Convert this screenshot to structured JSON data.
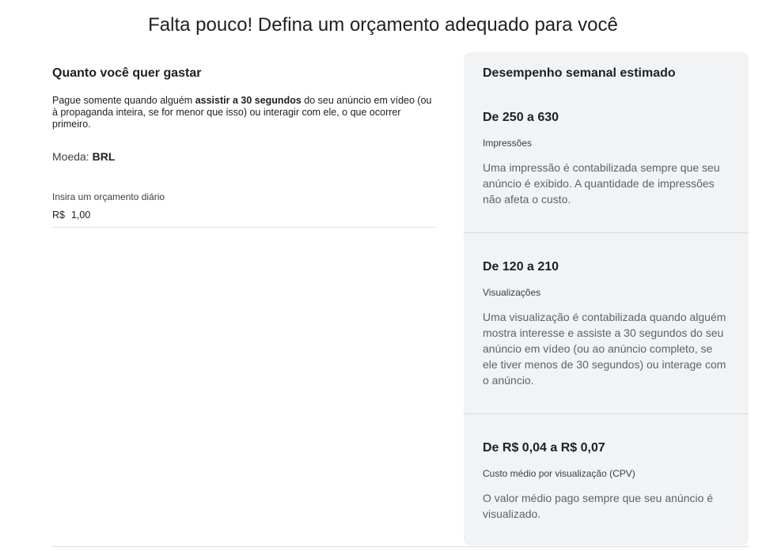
{
  "page_title": "Falta pouco! Defina um orçamento adequado para você",
  "budget_section": {
    "heading": "Quanto você quer gastar",
    "description_pre": "Pague somente quando alguém ",
    "description_bold": "assistir a 30 segundos",
    "description_post": " do seu anúncio em vídeo (ou à propaganda inteira, se for menor que isso) ou interagir com ele, o que ocorrer primeiro.",
    "currency_label": "Moeda:",
    "currency_value": "BRL",
    "budget_field_label": "Insira um orçamento diário",
    "budget_prefix": "R$",
    "budget_value": "1,00"
  },
  "performance": {
    "heading": "Desempenho semanal estimado",
    "metrics": [
      {
        "range": "De 250 a 630",
        "label": "Impressões",
        "description": "Uma impressão é contabilizada sempre que seu anúncio é exibido. A quantidade de impressões não afeta o custo."
      },
      {
        "range": "De 120 a 210",
        "label": "Visualizações",
        "description": "Uma visualização é contabilizada quando alguém mostra interesse e assiste a 30 segundos do seu anúncio em vídeo (ou ao anúncio completo, se ele tiver menos de 30 segundos) ou interage com o anúncio."
      },
      {
        "range": "De R$ 0,04 a R$ 0,07",
        "label": "Custo médio por visualização (CPV)",
        "description": "O valor médio pago sempre que seu anúncio é visualizado."
      }
    ]
  },
  "colors": {
    "panel_background": "#f1f3f4",
    "divider": "#dadce0",
    "text_primary": "#202124",
    "text_secondary": "#5f6368"
  }
}
